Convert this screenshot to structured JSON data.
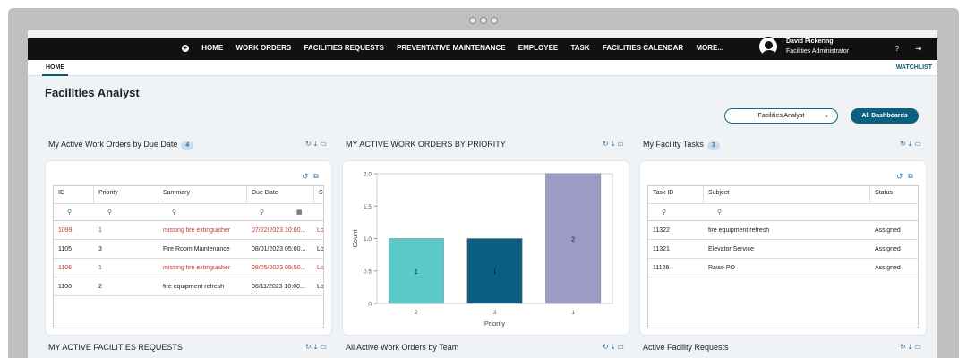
{
  "nav": {
    "items": [
      "HOME",
      "WORK ORDERS",
      "FACILITIES REQUESTS",
      "PREVENTATIVE MAINTENANCE",
      "EMPLOYEE",
      "TASK",
      "FACILITIES CALENDAR",
      "MORE..."
    ]
  },
  "user": {
    "name": "David Pickering",
    "role": "Facilities Administrator"
  },
  "tabs": {
    "home": "HOME",
    "watchlist": "WATCHLIST"
  },
  "page": {
    "title": "Facilities Analyst"
  },
  "controls": {
    "dashboard_select": "Facilities Analyst",
    "all_dashboards": "All Dashboards"
  },
  "sections": {
    "wo_due": {
      "title": "My Active Work Orders by Due Date",
      "count": "4"
    },
    "wo_priority": {
      "title": "MY ACTIVE WORK ORDERS BY PRIORITY"
    },
    "tasks": {
      "title": "My Facility Tasks",
      "count": "3"
    },
    "fac_requests": {
      "title": "MY ACTIVE FACILITIES REQUESTS"
    },
    "wo_team": {
      "title": "All Active Work Orders by Team"
    },
    "active_requests": {
      "title": "Active Facility Requests"
    }
  },
  "wo_table": {
    "columns": [
      "ID",
      "Priority",
      "Summary",
      "Due Date",
      "Sta"
    ],
    "rows": [
      {
        "id": "1099",
        "priority": "1",
        "summary": "missing fire extinguisher",
        "due": "07/22/2023 10:00...",
        "status": "Lo",
        "overdue": true
      },
      {
        "id": "1105",
        "priority": "3",
        "summary": "Fire Room Maintenance",
        "due": "08/01/2023 05:00...",
        "status": "Lo",
        "overdue": false
      },
      {
        "id": "1106",
        "priority": "1",
        "summary": "missing fire extinguisher",
        "due": "08/05/2023 09:50...",
        "status": "Lo",
        "overdue": true
      },
      {
        "id": "1108",
        "priority": "2",
        "summary": "fire equipment refresh",
        "due": "08/11/2023 10:00...",
        "status": "Lo",
        "overdue": false
      }
    ]
  },
  "task_table": {
    "columns": [
      "Task ID",
      "Subject",
      "Status"
    ],
    "rows": [
      {
        "id": "11322",
        "subject": "fire equipment refresh",
        "status": "Assigned"
      },
      {
        "id": "11321",
        "subject": "Elevator Service",
        "status": "Assigned"
      },
      {
        "id": "11126",
        "subject": "Raise PO",
        "status": "Assigned"
      }
    ]
  },
  "chart_data": {
    "type": "bar",
    "categories": [
      "2",
      "3",
      "1"
    ],
    "values": [
      1,
      1,
      2
    ],
    "colors": [
      "#5bc8c9",
      "#0b5f80",
      "#9b9bc6"
    ],
    "xlabel": "Priority",
    "ylabel": "Count",
    "ylim": [
      0,
      2.0
    ],
    "yticks": [
      "0",
      "0.5",
      "1.0",
      "1.5",
      "2.0"
    ]
  }
}
